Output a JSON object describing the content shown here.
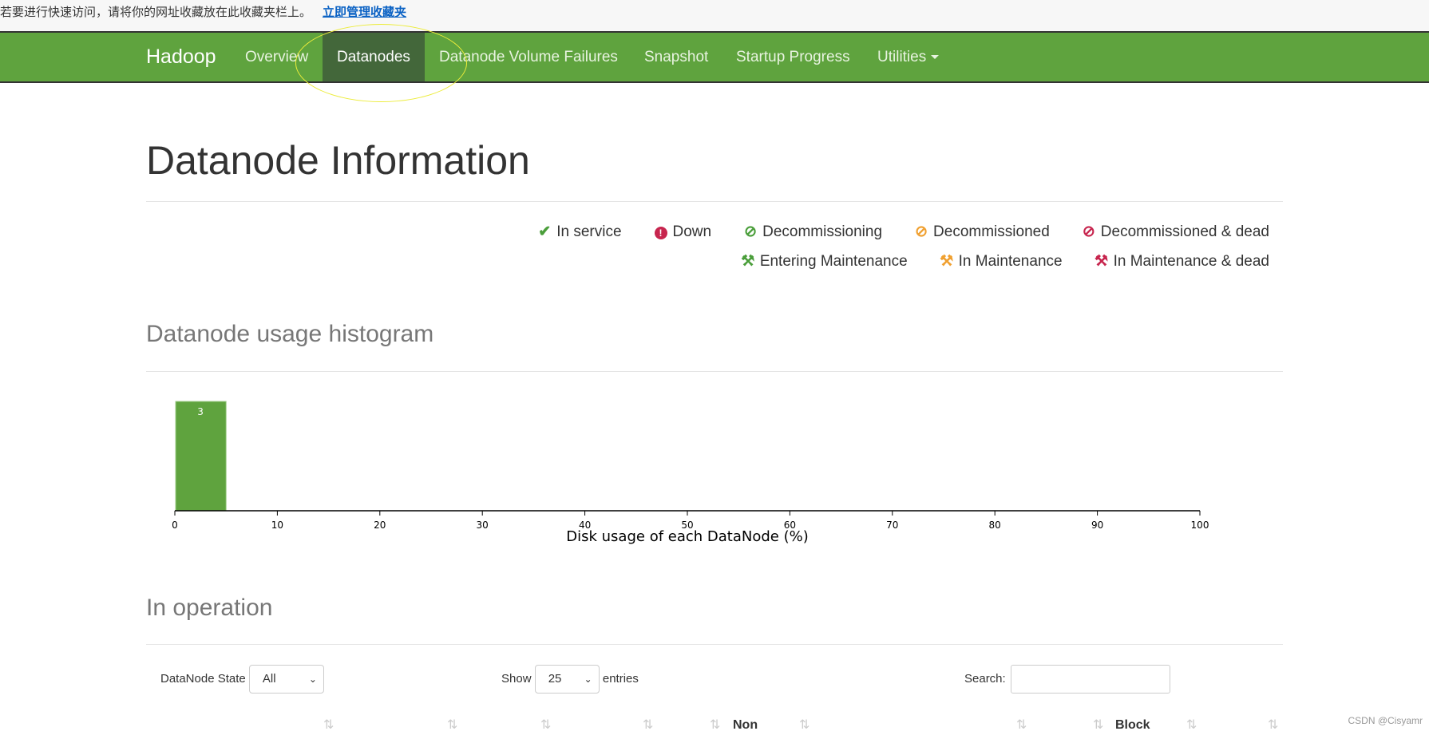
{
  "bookmark_bar": {
    "text": "若要进行快速访问，请将你的网址收藏放在此收藏夹栏上。",
    "link": "立即管理收藏夹"
  },
  "nav": {
    "brand": "Hadoop",
    "items": [
      "Overview",
      "Datanodes",
      "Datanode Volume Failures",
      "Snapshot",
      "Startup Progress",
      "Utilities"
    ],
    "active": "Datanodes"
  },
  "page_title": "Datanode Information",
  "legend": [
    {
      "icon": "check-icon",
      "label": "In service",
      "color": "#4a9e3a"
    },
    {
      "icon": "exclamation-circle-icon",
      "label": "Down",
      "color": "#c7254e"
    },
    {
      "icon": "ban-icon",
      "label": "Decommissioning",
      "color": "#4a9e3a"
    },
    {
      "icon": "ban-icon",
      "label": "Decommissioned",
      "color": "#f0a030"
    },
    {
      "icon": "ban-icon",
      "label": "Decommissioned & dead",
      "color": "#c7254e"
    },
    {
      "icon": "wrench-icon",
      "label": "Entering Maintenance",
      "color": "#4a9e3a"
    },
    {
      "icon": "wrench-icon",
      "label": "In Maintenance",
      "color": "#f0a030"
    },
    {
      "icon": "wrench-icon",
      "label": "In Maintenance & dead",
      "color": "#c7254e"
    }
  ],
  "histogram_title": "Datanode usage histogram",
  "chart_data": {
    "type": "bar",
    "xlabel": "Disk usage of each DataNode (%)",
    "xlim": [
      0,
      100
    ],
    "xticks": [
      0,
      10,
      20,
      30,
      40,
      50,
      60,
      70,
      80,
      90,
      100
    ],
    "bins": [
      {
        "x0": 0,
        "x1": 5,
        "count": 3
      }
    ],
    "bar_color": "#5fa33e"
  },
  "operation_title": "In operation",
  "controls": {
    "state_label": "DataNode State",
    "state_value": "All",
    "show_label": "Show",
    "show_value": "25",
    "entries_label": "entries",
    "search_label": "Search:",
    "search_value": ""
  },
  "table_headers_visible": [
    "Non",
    "Block"
  ],
  "watermark": "CSDN @Cisyamr"
}
